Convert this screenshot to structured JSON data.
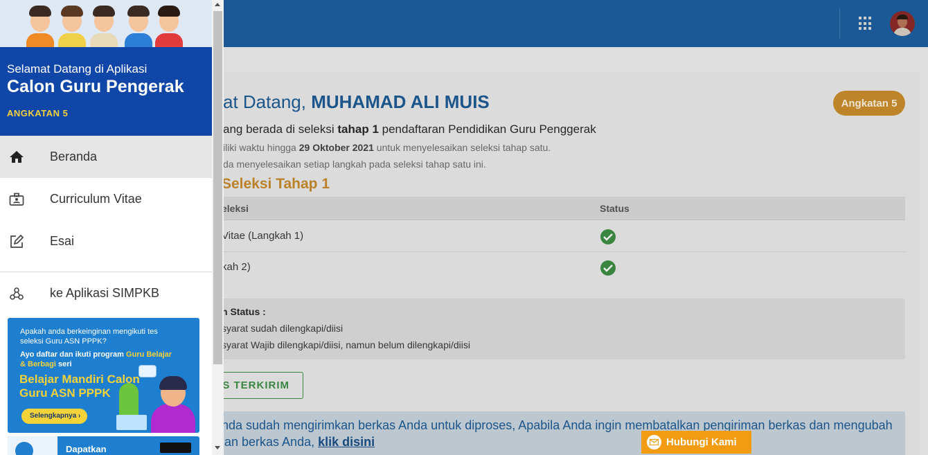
{
  "colors": {
    "topbar": "#1c5f9f",
    "drawer_header": "#1046a8",
    "accent_orange": "#c98d2d",
    "success_green": "#3e8f46",
    "contact_orange": "#f39c12"
  },
  "topbar": {
    "apps_icon": "apps-grid-icon",
    "avatar_icon": "user-avatar"
  },
  "main": {
    "welcome_prefix": "at Datang, ",
    "user_name": "MUHAMAD ALI MUIS",
    "batch_badge": "Angkatan 5",
    "lead_prefix": "ang berada di seleksi ",
    "lead_bold": "tahap 1",
    "lead_suffix": " pendaftaran Pendidikan Guru Penggerak",
    "note1_prefix": "iliki waktu hingga ",
    "note1_bold": "29 Oktober 2021",
    "note1_suffix": " untuk menyelesaikan seleksi tahap satu.",
    "note2": "da menyelesaikan setiap langkah pada seleksi tahap satu ini.",
    "section_title": "Seleksi Tahap 1",
    "table": {
      "headers": [
        "eleksi",
        "Status"
      ],
      "rows": [
        {
          "step": " Vitae (Langkah 1)",
          "status_icon": "check-circle-icon"
        },
        {
          "step": "kah 2)",
          "status_icon": "check-circle-icon"
        }
      ]
    },
    "legend": {
      "title": "n Status :",
      "items": [
        "syarat sudah dilengkapi/diisi",
        "syarat Wajib dilengkapi/diisi, namun belum dilengkapi/diisi"
      ]
    },
    "sent_button": "S TERKIRIM",
    "info_line1": "nda sudah mengirimkan berkas Anda untuk diproses, Apabila Anda ingin membatalkan pengiriman berkas dan mengubah",
    "info_line2_prefix": "ian berkas Anda, ",
    "info_link": "klik disini",
    "contact_button": "Hubungi Kami"
  },
  "drawer": {
    "welcome_small": "Selamat Datang di Aplikasi",
    "app_title": "Calon Guru Pengerak",
    "batch_label": "ANGKATAN 5",
    "nav": [
      {
        "label": "Beranda",
        "icon": "home-icon",
        "active": true
      },
      {
        "label": "Curriculum Vitae",
        "icon": "id-badge-icon",
        "active": false
      },
      {
        "label": "Esai",
        "icon": "edit-icon",
        "active": false
      },
      {
        "label": "ke Aplikasi SIMPKB",
        "icon": "webhook-icon",
        "active": false
      }
    ],
    "promo": {
      "question": "Apakah anda berkeinginan mengikuti tes seleksi Guru ASN PPPK?",
      "join_prefix": "Ayo daftar dan ikuti program ",
      "join_highlight": "Guru Belajar & Berbagi",
      "join_suffix": " seri",
      "title": "Belajar Mandiri Calon Guru ASN PPPK",
      "button": "Selengkapnya"
    },
    "app_banner": {
      "label": "Dapatkan"
    }
  }
}
